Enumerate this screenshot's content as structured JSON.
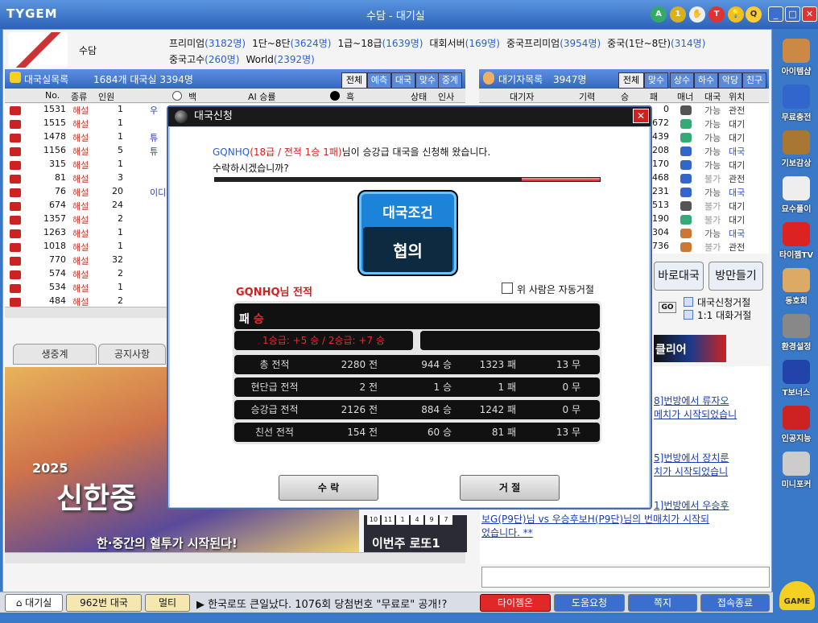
{
  "app": {
    "logo": "TYGEM",
    "title": "수담 - 대기실",
    "home_icon": "home-icon"
  },
  "user": {
    "name": "수담"
  },
  "servers": [
    {
      "label": "프리미엄",
      "count": "(3182명)"
    },
    {
      "label": "1단~8단",
      "count": "(3624명)"
    },
    {
      "label": "1급~18급",
      "count": "(1639명)"
    },
    {
      "label": "대회서버",
      "count": "(169명)"
    },
    {
      "label": "중국프리미엄",
      "count": "(3954명)"
    },
    {
      "label": "중국(1단~8단)",
      "count": "(314명)"
    },
    {
      "label": "중국고수",
      "count": "(260명)"
    },
    {
      "label": "World",
      "count": "(2392명)"
    }
  ],
  "roomlist": {
    "title": "대국실목록",
    "summary": "1684개 대국실  3394명",
    "tabs": [
      "전체",
      "예측",
      "대국",
      "맞수",
      "중계"
    ],
    "cols": {
      "no": "No.",
      "type": "종류",
      "people": "인원",
      "white": "백",
      "ai": "AI 승률",
      "black": "흑",
      "status": "상태",
      "extra": "인사"
    },
    "rows": [
      [
        "1531",
        "해설",
        "1"
      ],
      [
        "1515",
        "해설",
        "1"
      ],
      [
        "1478",
        "해설",
        "1"
      ],
      [
        "1156",
        "해설",
        "5"
      ],
      [
        "315",
        "해설",
        "1"
      ],
      [
        "81",
        "해설",
        "3"
      ],
      [
        "76",
        "해설",
        "20"
      ],
      [
        "674",
        "해설",
        "24"
      ],
      [
        "1357",
        "해설",
        "2"
      ],
      [
        "1263",
        "해설",
        "1"
      ],
      [
        "1018",
        "해설",
        "1"
      ],
      [
        "770",
        "해설",
        "32"
      ],
      [
        "574",
        "해설",
        "2"
      ],
      [
        "534",
        "해설",
        "1"
      ],
      [
        "484",
        "해설",
        "2"
      ]
    ],
    "partial": [
      "우",
      "",
      "튜",
      "튜",
      "",
      "",
      "이디",
      "",
      "",
      "",
      "",
      "",
      "",
      "",
      ""
    ]
  },
  "waitlist": {
    "title": "대기자목록",
    "summary": "3947명",
    "tabs": [
      "전체",
      "맞수",
      "상수",
      "하수",
      "악당",
      "친구"
    ],
    "cols": {
      "name": "대기자",
      "rank": "기력",
      "win": "승",
      "loss": "패",
      "manner": "매너",
      "match": "대국",
      "location": "위치"
    },
    "rows": [
      [
        "0",
        "가능",
        "관전"
      ],
      [
        "672",
        "가능",
        "대기"
      ],
      [
        "439",
        "가능",
        "대기"
      ],
      [
        "208",
        "가능",
        "대국"
      ],
      [
        "170",
        "가능",
        "대기"
      ],
      [
        "468",
        "불가",
        "관전"
      ],
      [
        "231",
        "가능",
        "대국"
      ],
      [
        "513",
        "불가",
        "대기"
      ],
      [
        "190",
        "불가",
        "대기"
      ],
      [
        "304",
        "가능",
        "대국"
      ],
      [
        "736",
        "불가",
        "관전"
      ]
    ]
  },
  "actions": {
    "quick": "바로대국",
    "watch": "방만들기",
    "go": "GO",
    "refuse_req": "대국신청거절",
    "refuse_chat": "1:1 대화거절",
    "banner_tag": "클리어"
  },
  "tabs2": [
    "생중계",
    "공지사항"
  ],
  "banner": {
    "text": "한·중간의 혈투가 시작된다!",
    "year": "2025",
    "title": "신한중",
    "lotto": "이번주 로또1",
    "lotto_nums": [
      "10",
      "11",
      "1",
      "4",
      "9",
      "7"
    ]
  },
  "news": [
    {
      "line1": "8]번방에서 류자오",
      "line2": "메치가 시작되었습니"
    },
    {
      "line1": "5]번방에서 장치룬",
      "line2": "치가 시작되었습니"
    },
    {
      "line1": "1]번방에서 우승후",
      "line2": "보G(P9단)님 vs 우승후보H(P9단)님의 번매치가 시작되",
      "line3": "었습니다. **"
    }
  ],
  "sidebar": [
    "아이템샵",
    "무료충전",
    "기보감상",
    "묘수풀이",
    "타이젬TV",
    "동호회",
    "환경설정",
    "T보너스",
    "인공지능",
    "미니포커"
  ],
  "taskbar": {
    "lobby": "대기실",
    "room": "962번 대국",
    "multi": "멀티",
    "ticker": "한국로또 큰일났다. 1076회 당첨번호 \"무료로\" 공개!?",
    "tv": "타이젬온",
    "help": "도움요청",
    "memo": "쪽지",
    "exit": "접속종료",
    "game": "GAME"
  },
  "dialog": {
    "title": "대국신청",
    "req_name": "GQNHQ",
    "req_info": "(18급 / 전적 1승 1패)",
    "req_text": "님이 승강급 대국을 신청해 왔습니다.",
    "question": "수락하시겠습니까?",
    "cond_title": "대국조건",
    "cond_value": "협의",
    "rec_title": "GQNHQ님 전적",
    "auto_decline": "위 사람은 자동거절",
    "ribbon1": "패",
    "ribbon2": "승",
    "grade": "1승급: +5 승 / 2승급: +7 승",
    "records": [
      {
        "label": "총 전적",
        "games": "2280 전",
        "win": "944 승",
        "loss": "1323 패",
        "draw": "13 무"
      },
      {
        "label": "현단급 전적",
        "games": "2 전",
        "win": "1 승",
        "loss": "1 패",
        "draw": "0 무"
      },
      {
        "label": "승강급 전적",
        "games": "2126 전",
        "win": "884 승",
        "loss": "1242 패",
        "draw": "0 무"
      },
      {
        "label": "친선 전적",
        "games": "154 전",
        "win": "60 승",
        "loss": "81 패",
        "draw": "13 무"
      }
    ],
    "accept": "수 락",
    "decline": "거 절"
  }
}
